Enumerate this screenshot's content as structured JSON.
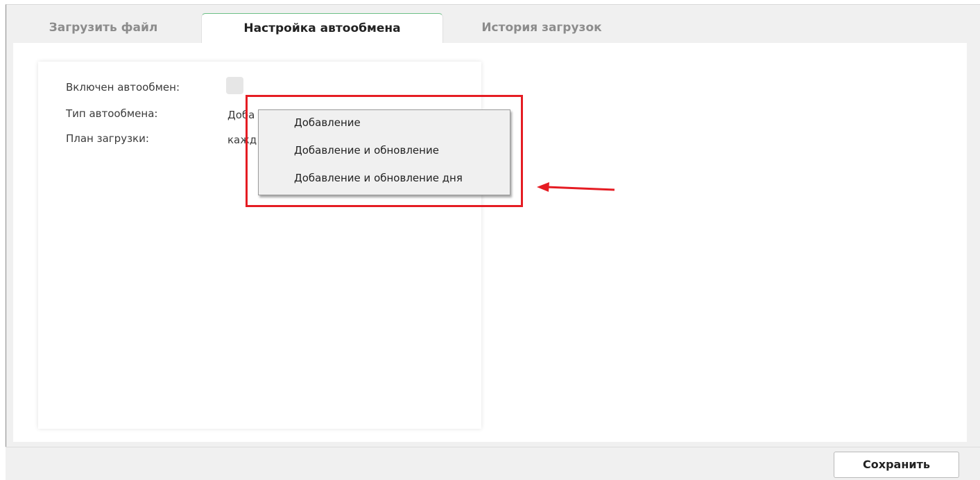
{
  "tabs": [
    {
      "label": "Загрузить файл",
      "active": false
    },
    {
      "label": "Настройка автообмена",
      "active": true
    },
    {
      "label": "История загрузок",
      "active": false
    }
  ],
  "settings": {
    "auto_exchange_label": "Включен автообмен:",
    "auto_exchange_checked": false,
    "exchange_type_label": "Тип автообмена:",
    "exchange_type_value": "Доба",
    "schedule_label": "План загрузки:",
    "schedule_value": "кажд"
  },
  "dropdown": {
    "options": [
      "Добавление",
      "Добавление и обновление",
      "Добавление и обновление дня"
    ]
  },
  "footer": {
    "save_label": "Сохранить"
  },
  "colors": {
    "accent": "#6cbf86",
    "highlight": "#e51c23"
  }
}
